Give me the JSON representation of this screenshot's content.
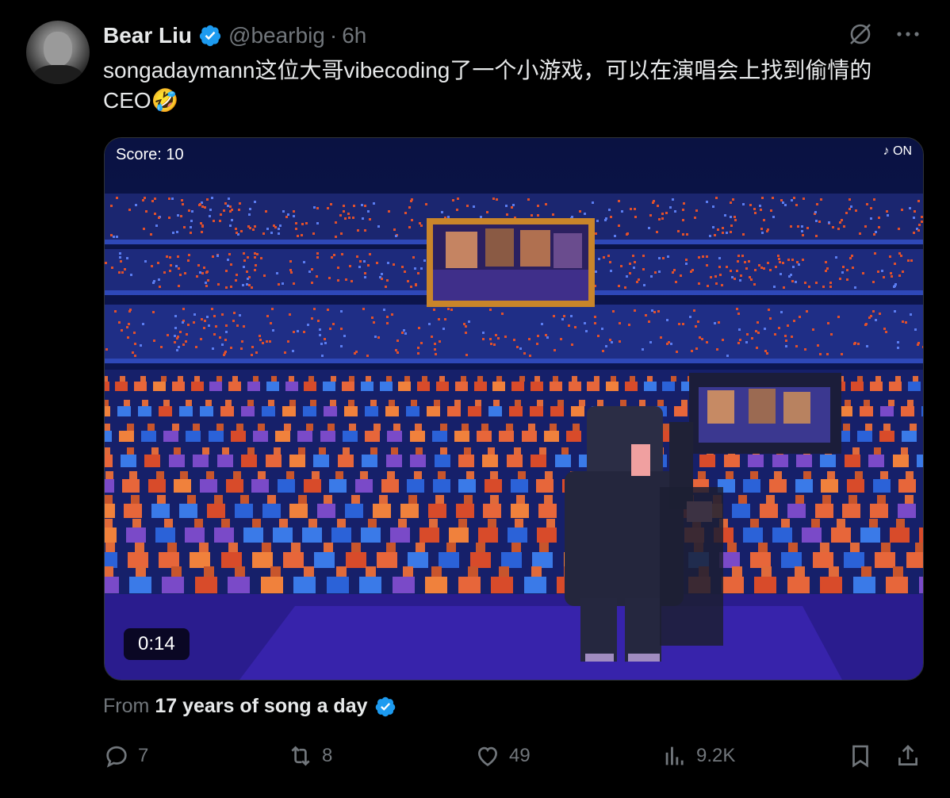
{
  "author": {
    "name": "Bear Liu",
    "handle": "@bearbig",
    "time": "6h",
    "dot": "·"
  },
  "tweet": {
    "text": "songadaymann这位大哥vibecoding了一个小游戏，可以在演唱会上找到偷情的CEO🤣"
  },
  "media": {
    "score": "Score: 10",
    "sound": "♪ ON",
    "duration": "0:14"
  },
  "source": {
    "label": "From",
    "name": "17 years of song a day"
  },
  "actions": {
    "replies": "7",
    "reposts": "8",
    "likes": "49",
    "views": "9.2K"
  },
  "colors": {
    "background": "#000000",
    "verified": "#1d9bf0",
    "muted": "#71767b",
    "text": "#e7e9ea"
  },
  "icons": [
    "verified-badge-icon",
    "grok-icon",
    "more-icon",
    "reply-icon",
    "repost-icon",
    "like-icon",
    "views-icon",
    "bookmark-icon",
    "share-icon"
  ]
}
